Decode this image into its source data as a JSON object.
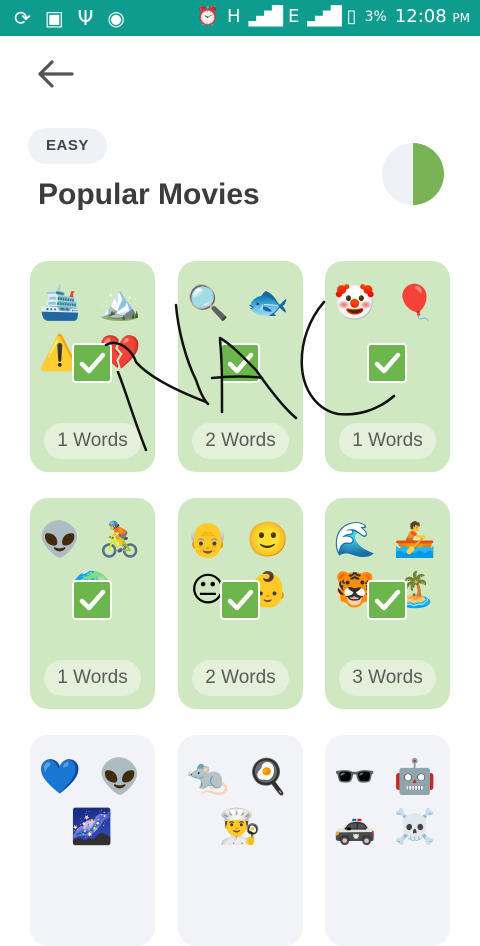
{
  "status_bar": {
    "left_icons": [
      "sync-icon",
      "image-icon",
      "usb-icon",
      "hotspot-icon"
    ],
    "alarm_icon": "alarm-icon",
    "network_1": "H",
    "network_2": "E",
    "battery_percent": "3%",
    "time": "12:08",
    "ampm": "PM"
  },
  "header": {
    "back_icon": "arrow-left-icon",
    "difficulty": "EASY",
    "title": "Popular Movies",
    "progress_fraction": 0.5,
    "progress_color": "#7ab355"
  },
  "cards": [
    {
      "emojis": [
        "🛳️",
        "🏔️",
        "⚠️",
        "💔"
      ],
      "words": "1 Words",
      "solved": true
    },
    {
      "emojis": [
        "🔍",
        "🐟",
        "",
        ""
      ],
      "words": "2 Words",
      "solved": true
    },
    {
      "emojis": [
        "🤡",
        "🎈",
        "",
        ""
      ],
      "words": "1 Words",
      "solved": true
    },
    {
      "emojis": [
        "👽",
        "🚴",
        "🌍",
        ""
      ],
      "words": "1 Words",
      "solved": true
    },
    {
      "emojis": [
        "👴",
        "🙂",
        "😐",
        "👶"
      ],
      "words": "2 Words",
      "solved": true
    },
    {
      "emojis": [
        "🌊",
        "🚣",
        "🐯",
        "🏝️"
      ],
      "words": "3 Words",
      "solved": true
    },
    {
      "emojis": [
        "💙",
        "👽",
        "🌌",
        ""
      ],
      "words": "",
      "solved": false
    },
    {
      "emojis": [
        "🐀",
        "🍳",
        "👨‍🍳",
        ""
      ],
      "words": "",
      "solved": false
    },
    {
      "emojis": [
        "🕶️",
        "🤖",
        "🚓",
        "☠️"
      ],
      "words": "",
      "solved": false
    }
  ],
  "colors": {
    "status_bar": "#0e9c8e",
    "card_solved": "#cfe8c2",
    "check": "#6cb64d"
  }
}
